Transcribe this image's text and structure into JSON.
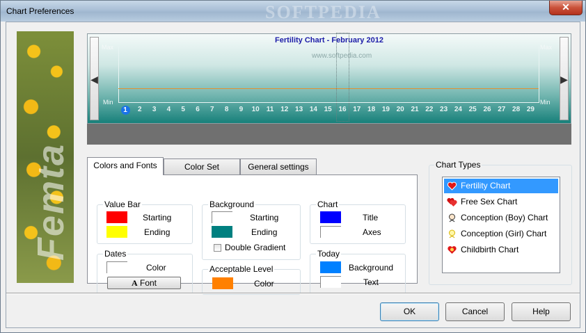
{
  "window": {
    "title": "Chart Preferences",
    "watermark": "SOFTPEDIA",
    "close_label": "✕"
  },
  "side_art": {
    "word": "Femta"
  },
  "chart": {
    "title": "Fertility Chart  -  February 2012",
    "watermark": "www.softpedia.com",
    "max_label": "Max",
    "min_label": "Min",
    "days": [
      "1",
      "2",
      "3",
      "4",
      "5",
      "6",
      "7",
      "8",
      "9",
      "10",
      "11",
      "12",
      "13",
      "14",
      "15",
      "16",
      "17",
      "18",
      "19",
      "20",
      "21",
      "22",
      "23",
      "24",
      "25",
      "26",
      "27",
      "28",
      "29"
    ],
    "today_index": 0,
    "highlight_index": 15
  },
  "tabs": [
    {
      "label": "Colors and Fonts",
      "active": true
    },
    {
      "label": "Color Set",
      "active": false
    },
    {
      "label": "General settings",
      "active": false
    }
  ],
  "colors": {
    "value_bar_starting": "#ff0000",
    "value_bar_ending": "#ffff00",
    "background_starting": "#ffffff",
    "background_ending": "#008080",
    "chart_title": "#0000ff",
    "chart_axes": "#ffffff",
    "dates_color": "#ffffff",
    "acceptable_level": "#ff8000",
    "today_background": "#0080ff",
    "today_text": "#ffffff"
  },
  "groups": {
    "value_bar": {
      "title": "Value Bar",
      "starting": "Starting",
      "ending": "Ending"
    },
    "background": {
      "title": "Background",
      "starting": "Starting",
      "ending": "Ending",
      "double_gradient": "Double Gradient"
    },
    "chart": {
      "title": "Chart",
      "title_label": "Title",
      "axes_label": "Axes"
    },
    "dates": {
      "title": "Dates",
      "color_label": "Color",
      "font_button": "Font"
    },
    "acceptable_level": {
      "title": "Acceptable Level",
      "color_label": "Color"
    },
    "today": {
      "title": "Today",
      "background_label": "Background",
      "text_label": "Text"
    }
  },
  "chart_types": {
    "title": "Chart Types",
    "items": [
      {
        "label": "Fertility Chart",
        "icon": "heart-icon",
        "selected": true
      },
      {
        "label": "Free Sex Chart",
        "icon": "double-heart-icon",
        "selected": false
      },
      {
        "label": "Conception (Boy) Chart",
        "icon": "boy-icon",
        "selected": false
      },
      {
        "label": "Conception (Girl) Chart",
        "icon": "girl-icon",
        "selected": false
      },
      {
        "label": "Childbirth Chart",
        "icon": "baby-icon",
        "selected": false
      }
    ]
  },
  "buttons": {
    "ok": "OK",
    "cancel": "Cancel",
    "help": "Help"
  }
}
